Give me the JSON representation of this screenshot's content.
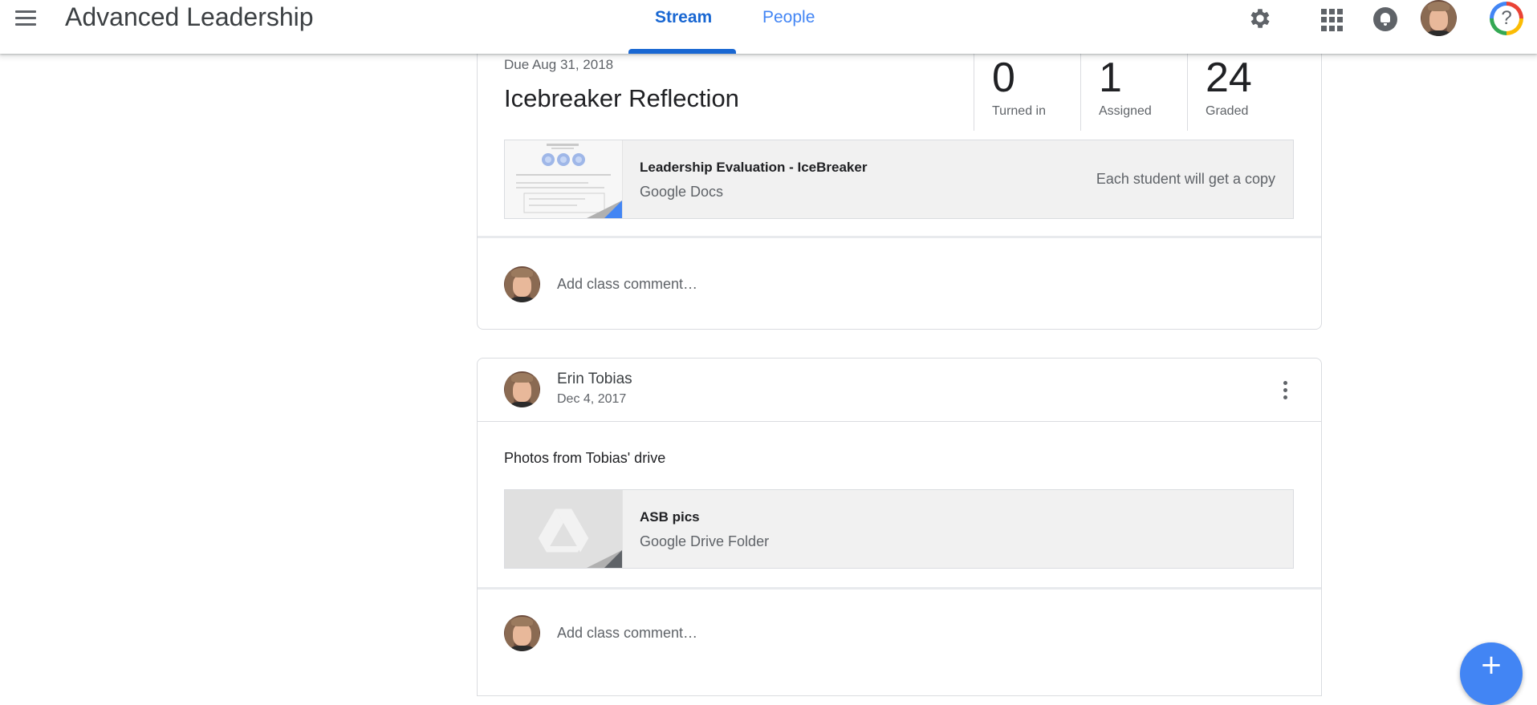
{
  "header": {
    "class_name": "Advanced Leadership",
    "tabs": [
      {
        "label": "Stream",
        "active": true
      },
      {
        "label": "People",
        "active": false
      }
    ],
    "icons": [
      "menu-icon",
      "gear-icon",
      "apps-grid-icon",
      "notifications-bell-icon",
      "help-icon"
    ],
    "help_glyph": "?"
  },
  "assignment": {
    "due": "Due Aug 31, 2018",
    "title": "Icebreaker Reflection",
    "stats": [
      {
        "value": "0",
        "label": "Turned in"
      },
      {
        "value": "1",
        "label": "Assigned"
      },
      {
        "value": "24",
        "label": "Graded"
      }
    ],
    "attachment": {
      "title": "Leadership Evaluation - IceBreaker",
      "type": "Google Docs",
      "note": "Each student will get a copy"
    },
    "comment_placeholder": "Add class comment…"
  },
  "post": {
    "author": "Erin Tobias",
    "date": "Dec 4, 2017",
    "text": "Photos from Tobias' drive",
    "attachment": {
      "title": "ASB pics",
      "type": "Google Drive Folder"
    },
    "comment_placeholder": "Add class comment…"
  },
  "fab_label": "+",
  "colors": {
    "accent": "#1967d2",
    "tab_inactive": "#4285f4",
    "fab": "#4285f4",
    "attachment_bg": "#f1f1f1"
  }
}
